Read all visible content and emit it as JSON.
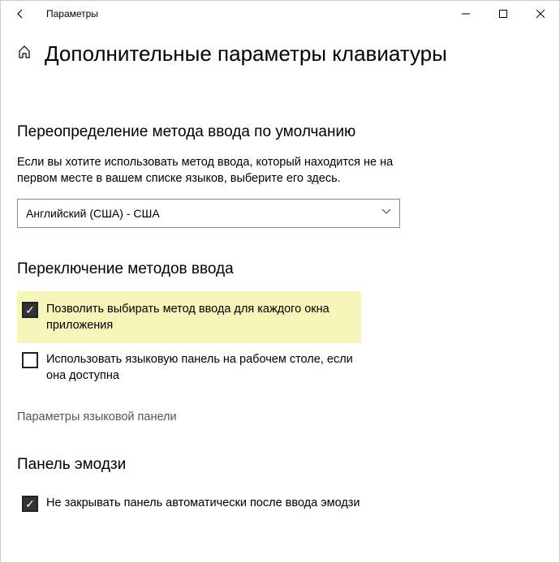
{
  "window": {
    "title": "Параметры"
  },
  "page": {
    "title": "Дополнительные параметры клавиатуры"
  },
  "section_override": {
    "title": "Переопределение метода ввода по умолчанию",
    "description": "Если вы хотите использовать метод ввода, который находится не на первом месте в вашем списке языков, выберите его здесь.",
    "selected": "Английский (США) - США"
  },
  "section_switch": {
    "title": "Переключение методов ввода",
    "checkbox1": {
      "label": "Позволить выбирать метод ввода для каждого окна приложения",
      "checked": true
    },
    "checkbox2": {
      "label": "Использовать языковую панель на рабочем столе, если она доступна",
      "checked": false
    },
    "link": "Параметры языковой панели"
  },
  "section_emoji": {
    "title": "Панель эмодзи",
    "checkbox": {
      "label": "Не закрывать панель автоматически после ввода эмодзи",
      "checked": true
    }
  }
}
